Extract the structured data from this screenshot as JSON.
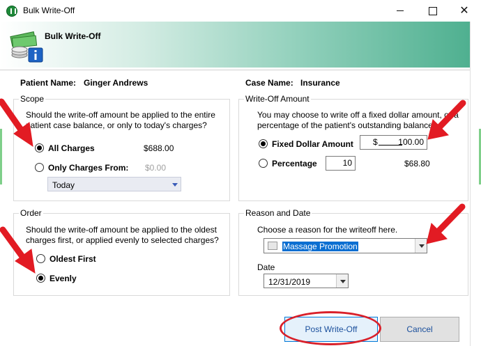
{
  "window": {
    "title": "Bulk Write-Off"
  },
  "banner": {
    "title": "Bulk Write-Off"
  },
  "patient": {
    "label": "Patient Name:",
    "value": "Ginger Andrews"
  },
  "case": {
    "label": "Case Name:",
    "value": "Insurance"
  },
  "scope": {
    "title": "Scope",
    "question": "Should the write-off amount be applied to the entire patient case balance, or only to today's charges?",
    "all_charges_label": "All Charges",
    "all_charges_amount": "$688.00",
    "only_from_label": "Only Charges From:",
    "only_from_amount": "$0.00",
    "date_option": "Today",
    "selected": "All Charges"
  },
  "writeoff": {
    "title": "Write-Off Amount",
    "description": "You may choose to write off a fixed dollar amount, or a percentage of the patient's outstanding balance.",
    "fixed_label": "Fixed Dollar Amount",
    "fixed_prefix": "$",
    "fixed_value": "100.00",
    "percentage_label": "Percentage",
    "percentage_value": "10",
    "percentage_amount": "$68.80",
    "selected": "Fixed Dollar Amount"
  },
  "order": {
    "title": "Order",
    "question": "Should the write-off amount be applied to the oldest charges first, or applied evenly to selected charges?",
    "oldest_label": "Oldest First",
    "evenly_label": "Evenly",
    "selected": "Evenly"
  },
  "reason": {
    "title": "Reason and Date",
    "prompt": "Choose a reason for the writeoff here.",
    "selected_reason": "Massage Promotion",
    "date_label": "Date",
    "date_value": "12/31/2019"
  },
  "buttons": {
    "post": "Post Write-Off",
    "cancel": "Cancel"
  },
  "colors": {
    "annotation_red": "#e21b23",
    "banner_accent": "#4fb090",
    "selection_blue": "#0a6ed1"
  }
}
